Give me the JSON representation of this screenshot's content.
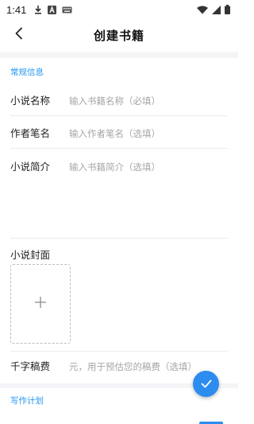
{
  "status_bar": {
    "time": "1:41",
    "left_icons": [
      "download-icon",
      "font-a-icon",
      "keyboard-icon"
    ],
    "right_icons": [
      "wifi-icon",
      "signal-icon",
      "battery-icon"
    ]
  },
  "header": {
    "title": "创建书籍",
    "back_icon": "chevron-left-icon"
  },
  "sections": {
    "general": "常规信息",
    "writing_plan": "写作计划"
  },
  "form": {
    "novel_name": {
      "label": "小说名称",
      "placeholder": "输入书籍名称（必填）",
      "value": ""
    },
    "pen_name": {
      "label": "作者笔名",
      "placeholder": "输入作者笔名（选填）",
      "value": ""
    },
    "intro": {
      "label": "小说简介",
      "placeholder": "输入书籍简介（选填）",
      "value": ""
    },
    "cover": {
      "label": "小说封面",
      "icon": "plus-icon"
    },
    "price": {
      "label": "千字稿费",
      "placeholder": "元，用于预估您的稿费（选填）",
      "value": ""
    }
  },
  "fab": {
    "icon": "check-icon"
  },
  "colors": {
    "accent": "#2196f3",
    "fab": "#2d8cf0",
    "divider": "#ebebeb",
    "placeholder": "#a6a6a6"
  }
}
